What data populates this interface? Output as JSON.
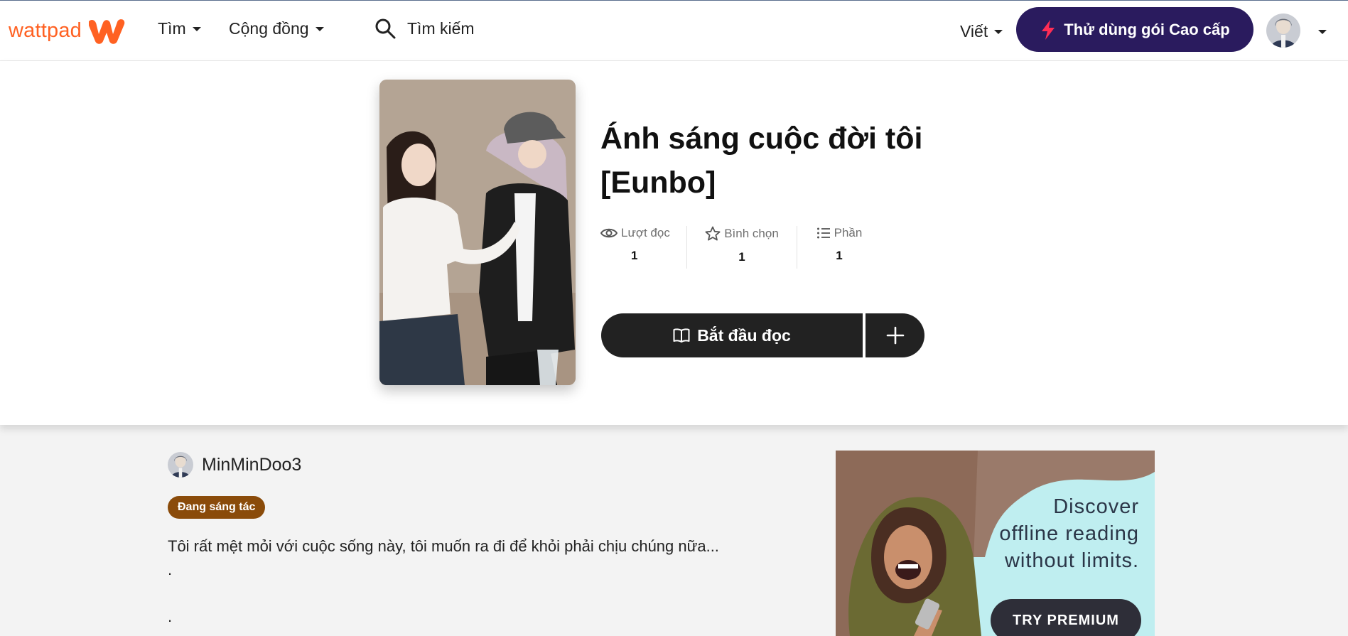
{
  "nav": {
    "logo_text": "wattpad",
    "browse_label": "Tìm",
    "community_label": "Cộng đồng",
    "search_label": "Tìm kiếm",
    "write_label": "Viết",
    "premium_label": "Thử dùng gói Cao cấp",
    "brand_color": "#ff6122",
    "premium_color": "#2a1b5e"
  },
  "story": {
    "title": "Ánh sáng cuộc đời tôi [Eunbo]",
    "stats": [
      {
        "label": "Lượt đọc",
        "value": "1",
        "icon": "eye-icon"
      },
      {
        "label": "Bình chọn",
        "value": "1",
        "icon": "star-icon"
      },
      {
        "label": "Phần",
        "value": "1",
        "icon": "list-icon"
      }
    ],
    "start_reading_label": "Bắt đầu đọc"
  },
  "author": {
    "name": "MinMinDoo3"
  },
  "status_badge": "Đang sáng tác",
  "description": {
    "line1": "Tôi rất mệt mỏi với cuộc sống này, tôi muốn ra đi để khỏi phải chịu chúng nữa...",
    "line2": ".",
    "line3": "."
  },
  "ad": {
    "line1": "Discover",
    "line2": "offline reading",
    "line3": "without limits.",
    "button_label": "TRY PREMIUM"
  }
}
